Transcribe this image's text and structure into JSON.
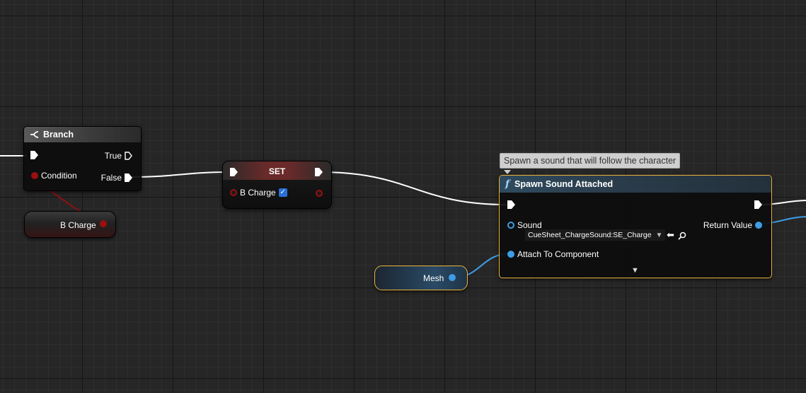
{
  "branch": {
    "title": "Branch",
    "true_label": "True",
    "false_label": "False",
    "condition_label": "Condition"
  },
  "bcharge_getter": {
    "label": "B Charge"
  },
  "set_node": {
    "title": "SET",
    "var_label": "B Charge",
    "checked": true
  },
  "spawn_node": {
    "tooltip": "Spawn a sound that will follow the character",
    "func_icon": "f",
    "title": "Spawn Sound Attached",
    "sound_label": "Sound",
    "sound_value": "CueSheet_ChargeSound:SE_Charge",
    "return_label": "Return Value",
    "attach_label": "Attach To Component",
    "expand_icon": "▼"
  },
  "mesh_getter": {
    "label": "Mesh"
  },
  "colors": {
    "exec": "#ffffff",
    "bool": "#9a0f0f",
    "object": "#3d9de6",
    "func_header": "#2f4a5e",
    "selected": "#e8b23a"
  }
}
